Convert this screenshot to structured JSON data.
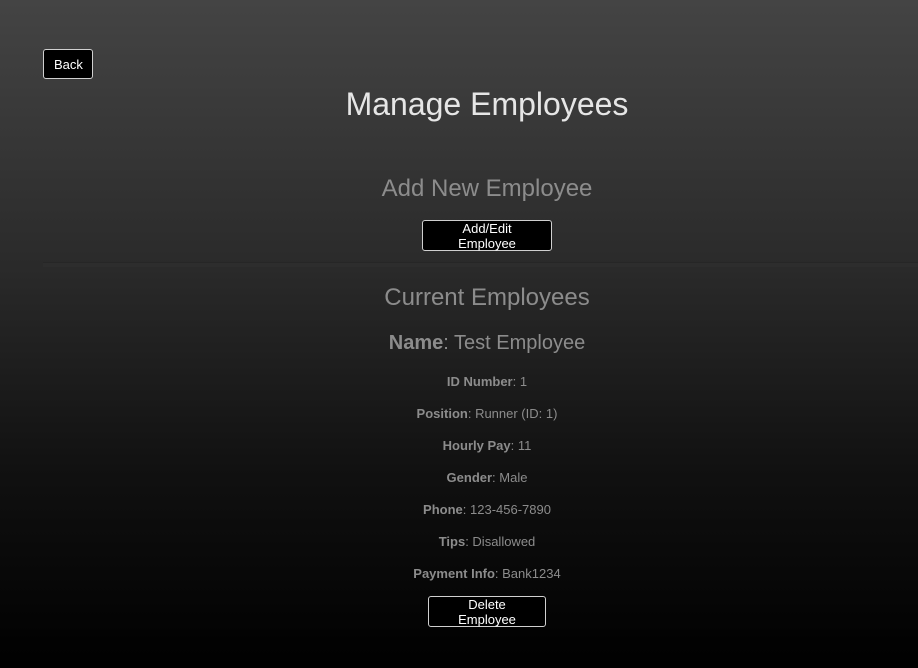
{
  "nav": {
    "back_label": "Back"
  },
  "page": {
    "title": "Manage Employees"
  },
  "add_section": {
    "heading": "Add New Employee",
    "button_label": "Add/Edit Employee"
  },
  "current_section": {
    "heading": "Current Employees",
    "employee": {
      "name_label": "Name",
      "name_value": "Test Employee",
      "fields": [
        {
          "label": "ID Number",
          "value": "1"
        },
        {
          "label": "Position",
          "value": "Runner (ID: 1)"
        },
        {
          "label": "Hourly Pay",
          "value": "11"
        },
        {
          "label": "Gender",
          "value": "Male"
        },
        {
          "label": "Phone",
          "value": "123-456-7890"
        },
        {
          "label": "Tips",
          "value": "Disallowed"
        },
        {
          "label": "Payment Info",
          "value": "Bank1234"
        }
      ],
      "delete_label": "Delete Employee"
    }
  },
  "colors": {
    "button_bg": "#000000",
    "button_border": "#d0d0d0",
    "heading_gray": "#8c8c8c",
    "title_color": "#e6e6e6"
  }
}
